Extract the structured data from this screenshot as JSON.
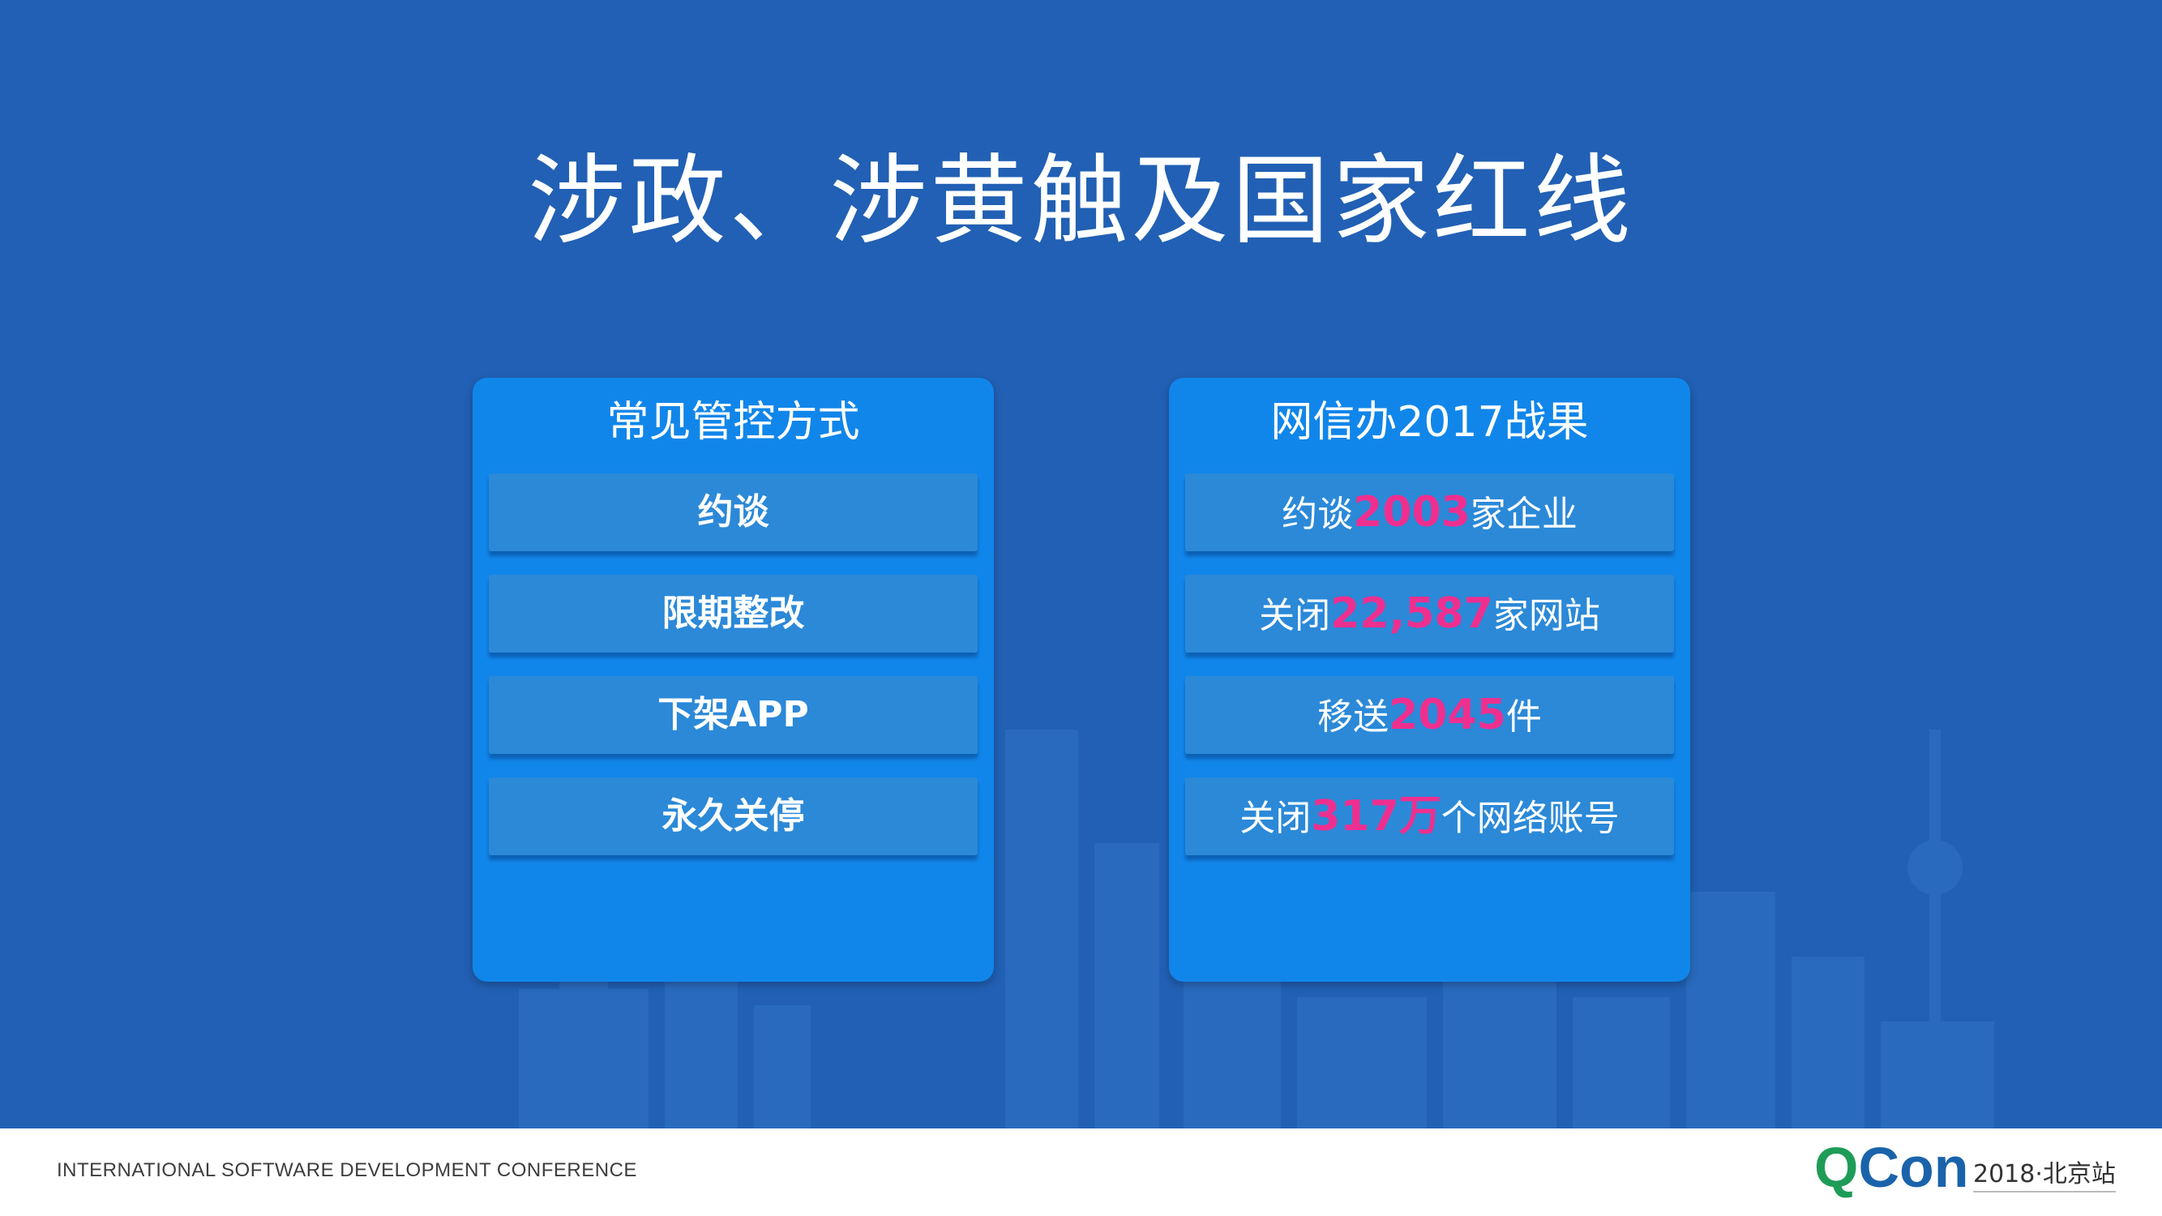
{
  "slide": {
    "title": "涉政、涉黄触及国家红线",
    "colors": {
      "background": "#2160b4",
      "card": "#1186ea",
      "row": "#2b89d8",
      "highlight": "#ef2f8f"
    }
  },
  "left_card": {
    "title": "常见管控方式",
    "items": [
      "约谈",
      "限期整改",
      "下架APP",
      "永久关停"
    ]
  },
  "right_card": {
    "title": "网信办2017战果",
    "items": [
      {
        "prefix": "约谈",
        "highlight": "2003",
        "suffix": "家企业"
      },
      {
        "prefix": "关闭",
        "highlight": "22,587",
        "suffix": "家网站"
      },
      {
        "prefix": "移送",
        "highlight": "2045",
        "suffix": "件"
      },
      {
        "prefix": "关闭",
        "highlight": "317万",
        "suffix": "个网络账号"
      }
    ]
  },
  "footer": {
    "conference": "INTERNATIONAL SOFTWARE DEVELOPMENT CONFERENCE",
    "brand_q": "Q",
    "brand_con": "Con",
    "edition": "2018·北京站",
    "brand_colors": {
      "q": "#1e9c57",
      "con": "#1a63ab"
    }
  }
}
